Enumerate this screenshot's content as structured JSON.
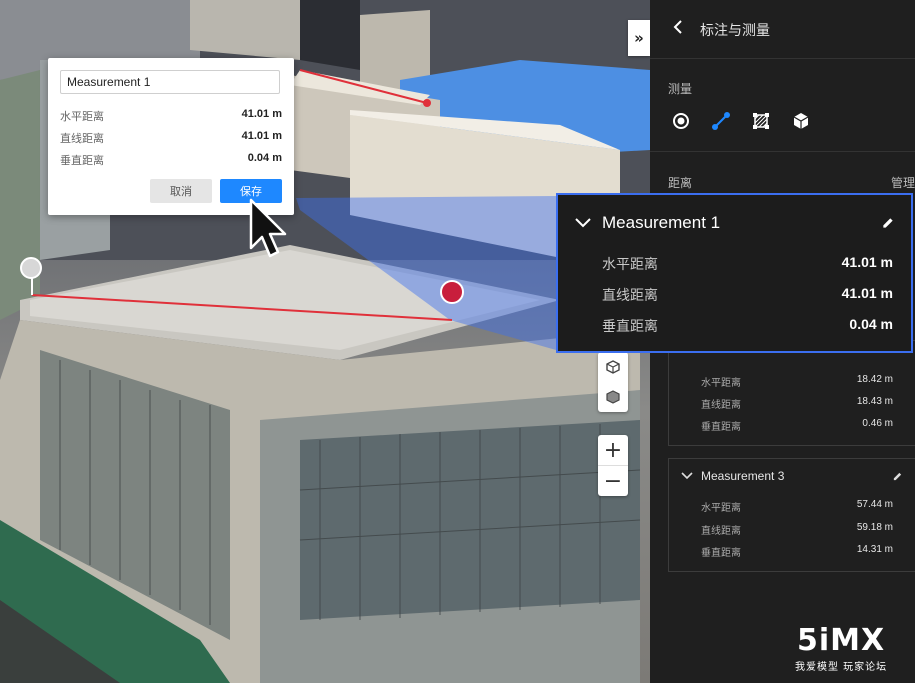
{
  "scene": {
    "collapse_glyph": "»",
    "zoom_in": "+",
    "zoom_out": "−"
  },
  "popup": {
    "name_value": "Measurement 1",
    "rows": [
      {
        "label": "水平距离",
        "value": "41.01 m"
      },
      {
        "label": "直线距离",
        "value": "41.01 m"
      },
      {
        "label": "垂直距离",
        "value": "0.04 m"
      }
    ],
    "cancel_label": "取消",
    "save_label": "保存"
  },
  "card": {
    "title": "Measurement 1",
    "rows": [
      {
        "label": "水平距离",
        "value": "41.01 m"
      },
      {
        "label": "直线距离",
        "value": "41.01 m"
      },
      {
        "label": "垂直距离",
        "value": "0.04 m"
      }
    ]
  },
  "panel": {
    "title": "标注与测量",
    "measure_label": "测量",
    "distance_label": "距离",
    "manage_label": "管理",
    "tools": [
      "point-tool-icon",
      "line-tool-icon",
      "area-tool-icon",
      "volume-tool-icon"
    ],
    "measurements": [
      {
        "title": "",
        "rows": [
          {
            "label": "水平距离",
            "value": "18.42 m"
          },
          {
            "label": "直线距离",
            "value": "18.43 m"
          },
          {
            "label": "垂直距离",
            "value": "0.46 m"
          }
        ]
      },
      {
        "title": "Measurement 3",
        "rows": [
          {
            "label": "水平距离",
            "value": "57.44 m"
          },
          {
            "label": "直线距离",
            "value": "59.18 m"
          },
          {
            "label": "垂直距离",
            "value": "14.31 m"
          }
        ]
      }
    ]
  },
  "watermark": {
    "logo": "5iMX",
    "sub": "我爱模型 玩家论坛"
  },
  "colors": {
    "accent": "#1e88ff",
    "highlight_border": "#3b6ef0",
    "measure_line": "#e0303a",
    "panel_bg": "#1f1f1f"
  }
}
